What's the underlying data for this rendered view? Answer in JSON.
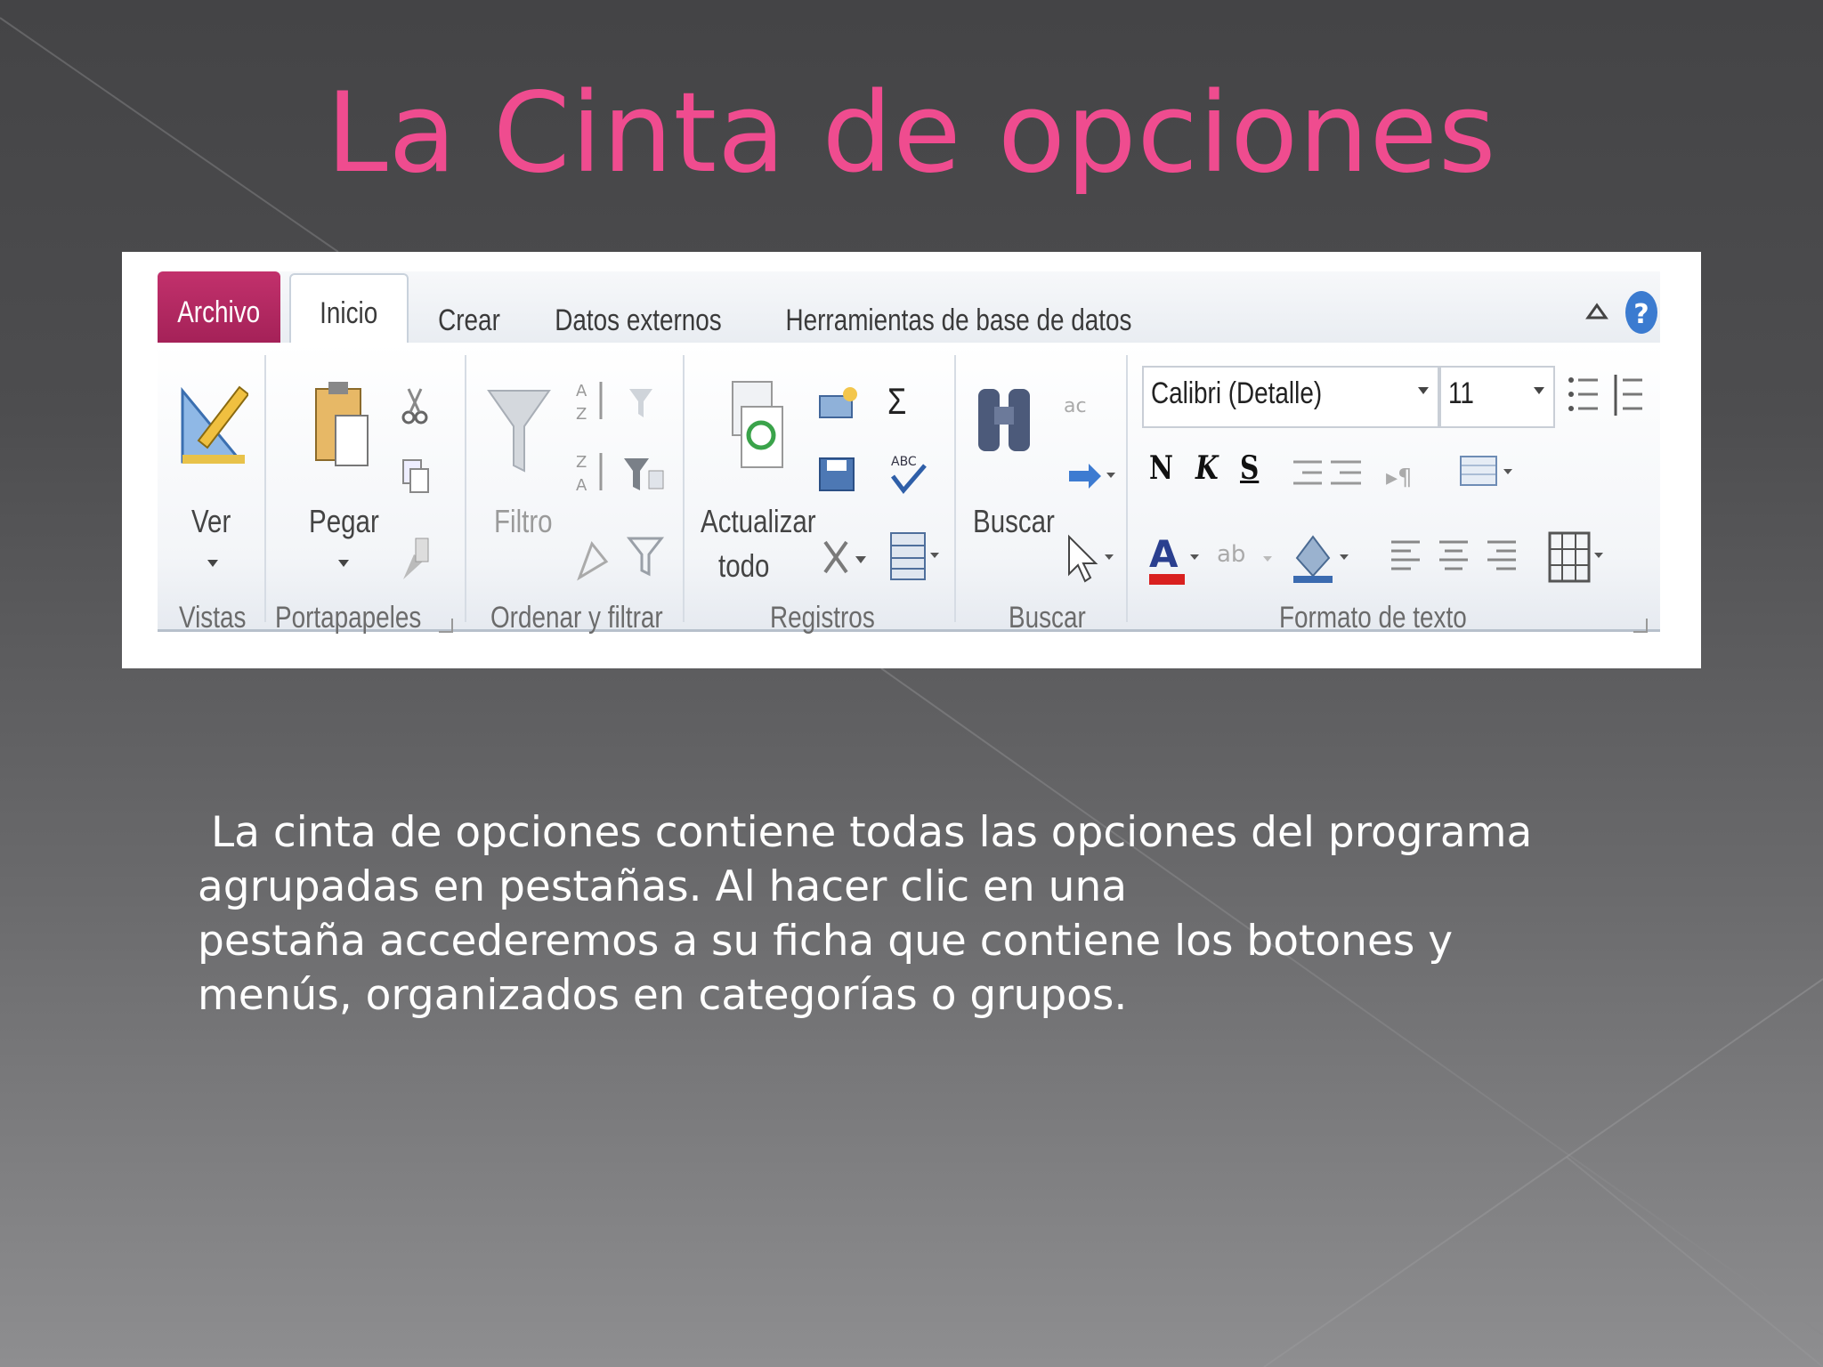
{
  "slide": {
    "title": "La Cinta de opciones",
    "body_lines": [
      " La cinta de opciones contiene todas las opciones del programa",
      "agrupadas en pestañas. Al hacer clic en una",
      "pestaña accederemos a su ficha que contiene los botones y",
      "menús, organizados en categorías o grupos."
    ]
  },
  "colors": {
    "title": "#ef4c8f",
    "archivo_tab": "#b0245f",
    "background": "#4d4d4f"
  },
  "ribbon": {
    "tabs": [
      "Archivo",
      "Inicio",
      "Crear",
      "Datos externos",
      "Herramientas de base de datos"
    ],
    "active_tab": "Inicio",
    "buttons": {
      "ver": "Ver",
      "pegar": "Pegar",
      "filtro": "Filtro",
      "actualizar_line1": "Actualizar",
      "actualizar_line2": "todo",
      "buscar": "Buscar",
      "bold": "N",
      "italic": "K",
      "underline": "S",
      "sum": "Σ"
    },
    "font_name": "Calibri (Detalle)",
    "font_size": "11",
    "groups": [
      "Vistas",
      "Portapapeles",
      "Ordenar y filtrar",
      "Registros",
      "Buscar",
      "Formato de texto"
    ],
    "icons": [
      "minimize-ribbon-icon",
      "help-icon",
      "view-icon",
      "paste-icon",
      "cut-icon",
      "copy-icon",
      "format-painter-icon",
      "filter-icon",
      "sort-ascending-icon",
      "sort-descending-icon",
      "refresh-icon",
      "new-record-icon",
      "delete-icon",
      "find-icon",
      "replace-icon",
      "font-color-icon",
      "highlight-icon",
      "align-left-icon",
      "align-center-icon",
      "align-right-icon",
      "gridlines-icon"
    ]
  }
}
